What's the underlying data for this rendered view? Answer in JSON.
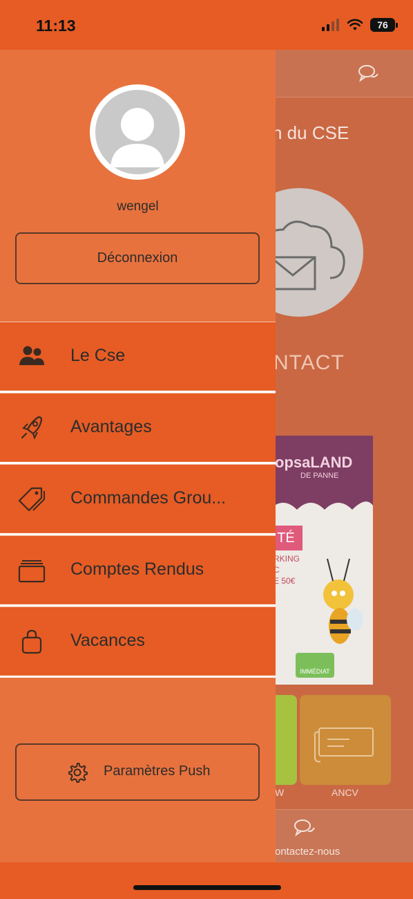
{
  "status_bar": {
    "time": "11:13",
    "battery": "76"
  },
  "background": {
    "title_fragment": "n du CSE",
    "contact_fragment": "NTACT",
    "ad": {
      "logo": "opsaLAND",
      "logo_sub": "DE PANNE",
      "ete": "TÉ",
      "lines": [
        "RKING",
        "C",
        "E 50€"
      ],
      "badge": "IMMÉDIAT"
    },
    "tile_labels": {
      "left": "W",
      "right": "ANCV"
    },
    "footer_label": "ontactez-nous"
  },
  "drawer": {
    "username": "wengel",
    "logout_label": "Déconnexion",
    "menu": [
      {
        "label": "Le Cse",
        "icon": "users-icon"
      },
      {
        "label": "Avantages",
        "icon": "rocket-icon"
      },
      {
        "label": "Commandes Grou...",
        "icon": "tag-icon"
      },
      {
        "label": "Comptes Rendus",
        "icon": "cards-icon"
      },
      {
        "label": "Vacances",
        "icon": "bag-icon"
      }
    ],
    "push_label": "Paramètres Push"
  },
  "colors": {
    "accent": "#e65c24",
    "drawer": "#e8723d",
    "text": "#2c2c2c"
  }
}
